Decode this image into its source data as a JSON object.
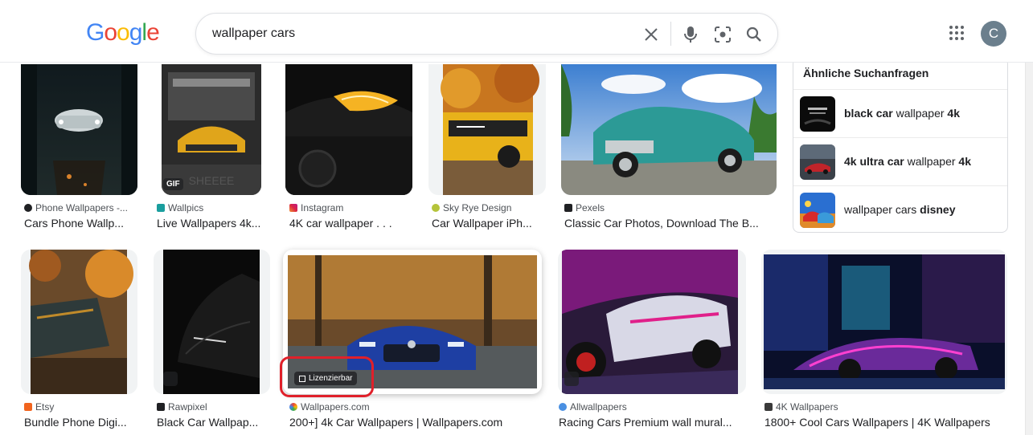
{
  "search": {
    "query": "wallpaper cars",
    "logo_letters": [
      {
        "ch": "G",
        "color": "#4285F4"
      },
      {
        "ch": "o",
        "color": "#EA4335"
      },
      {
        "ch": "o",
        "color": "#FBBC05"
      },
      {
        "ch": "g",
        "color": "#4285F4"
      },
      {
        "ch": "l",
        "color": "#34A853"
      },
      {
        "ch": "e",
        "color": "#EA4335"
      }
    ]
  },
  "account": {
    "initial": "C"
  },
  "results_row1": [
    {
      "source": "Phone Wallpapers -...",
      "title": "Cars Phone Wallp..."
    },
    {
      "source": "Wallpics",
      "title": "Live Wallpapers 4k...",
      "badge": "GIF"
    },
    {
      "source": "Instagram",
      "title": "4K car wallpaper . . ."
    },
    {
      "source": "Sky Rye Design",
      "title": "Car Wallpaper iPh..."
    },
    {
      "source": "Pexels",
      "title": "Classic Car Photos, Download The B..."
    }
  ],
  "results_row2": [
    {
      "source": "Etsy",
      "title": "Bundle Phone Digi..."
    },
    {
      "source": "Rawpixel",
      "title": "Black Car Wallpap..."
    },
    {
      "source": "Wallpapers.com",
      "title": "200+] 4k Car Wallpapers | Wallpapers.com",
      "badge": "Lizenzierbar"
    },
    {
      "source": "Allwallpapers",
      "title": "Racing Cars Premium wall mural..."
    },
    {
      "source": "4K Wallpapers",
      "title": "1800+ Cool Cars Wallpapers | 4K Wallpapers"
    }
  ],
  "related": {
    "title": "Ähnliche Suchanfragen",
    "items": [
      {
        "bold1": "black car",
        "normal": " wallpaper ",
        "bold2": "4k"
      },
      {
        "bold1": "4k ultra car",
        "normal": " wallpaper ",
        "bold2": "4k"
      },
      {
        "bold1": "",
        "normal": "wallpaper cars ",
        "bold2": "disney"
      }
    ]
  }
}
